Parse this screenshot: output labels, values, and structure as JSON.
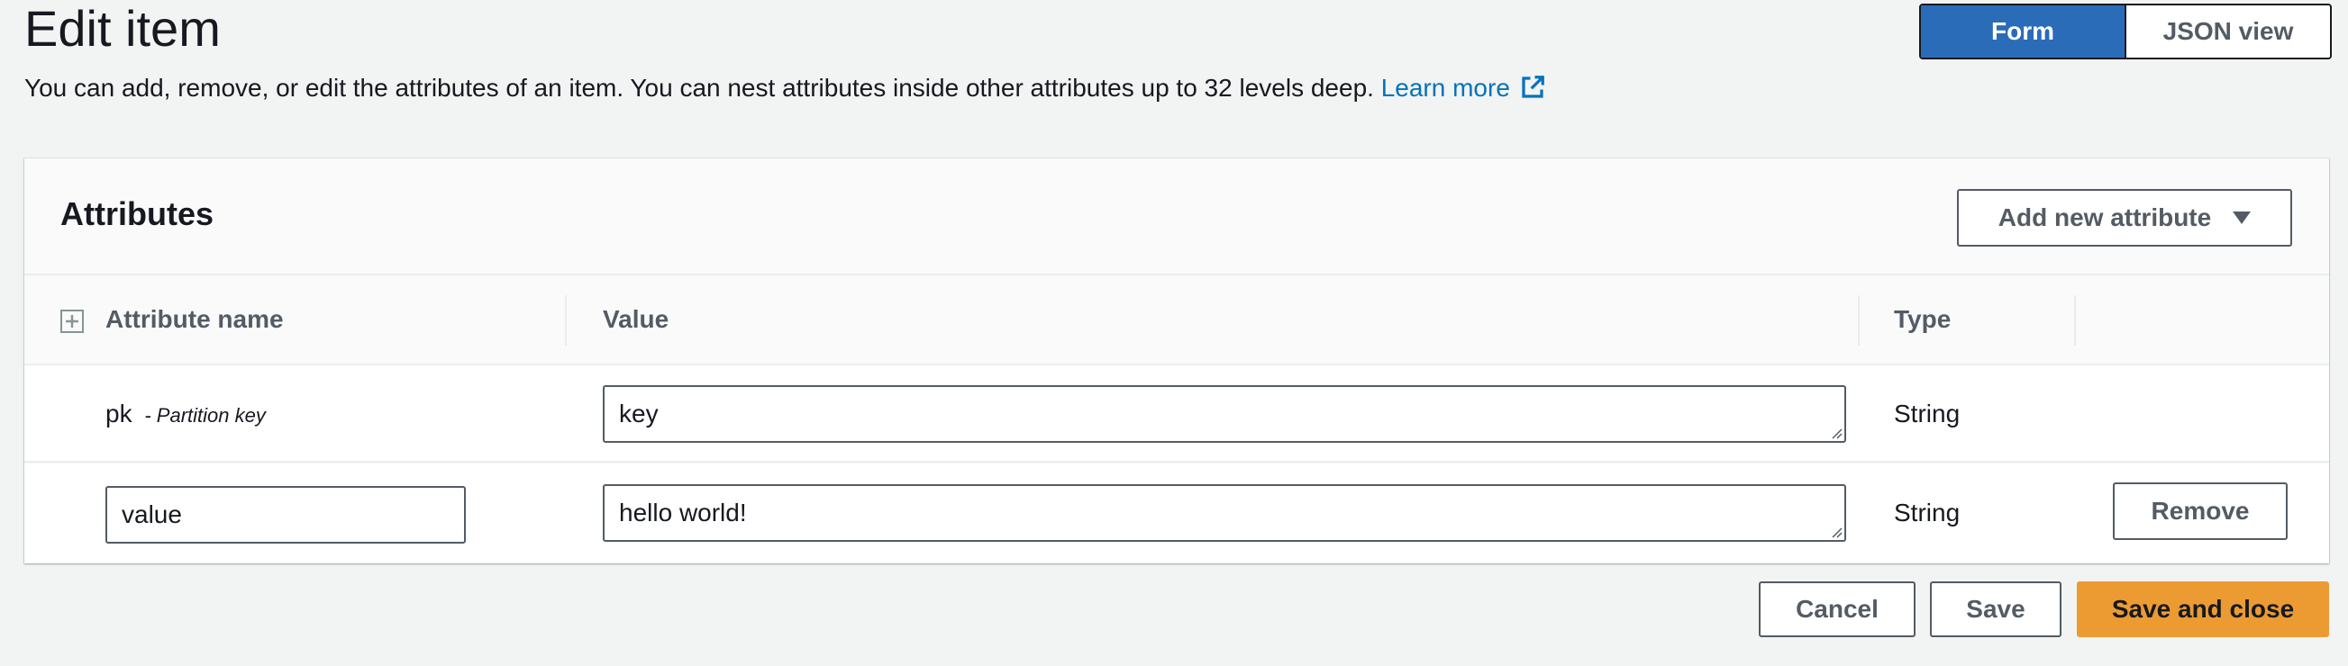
{
  "header": {
    "title": "Edit item",
    "description": "You can add, remove, or edit the attributes of an item. You can nest attributes inside other attributes up to 32 levels deep.",
    "learn_more": "Learn more"
  },
  "view_toggle": {
    "form_label": "Form",
    "json_label": "JSON view",
    "selected": "Form"
  },
  "attributes": {
    "title": "Attributes",
    "add_button": "Add new attribute",
    "columns": {
      "name": "Attribute name",
      "value": "Value",
      "type": "Type"
    },
    "rows": [
      {
        "name": "pk",
        "name_note": "- Partition key",
        "value": "key",
        "type": "String"
      },
      {
        "name": "value",
        "value": "hello world!",
        "type": "String",
        "remove_label": "Remove"
      }
    ]
  },
  "footer": {
    "cancel_label": "Cancel",
    "save_label": "Save",
    "save_close_label": "Save and close"
  },
  "colors": {
    "accent": "#2b6cb8",
    "primary_button": "#ec9b33",
    "link": "#0073bb"
  }
}
